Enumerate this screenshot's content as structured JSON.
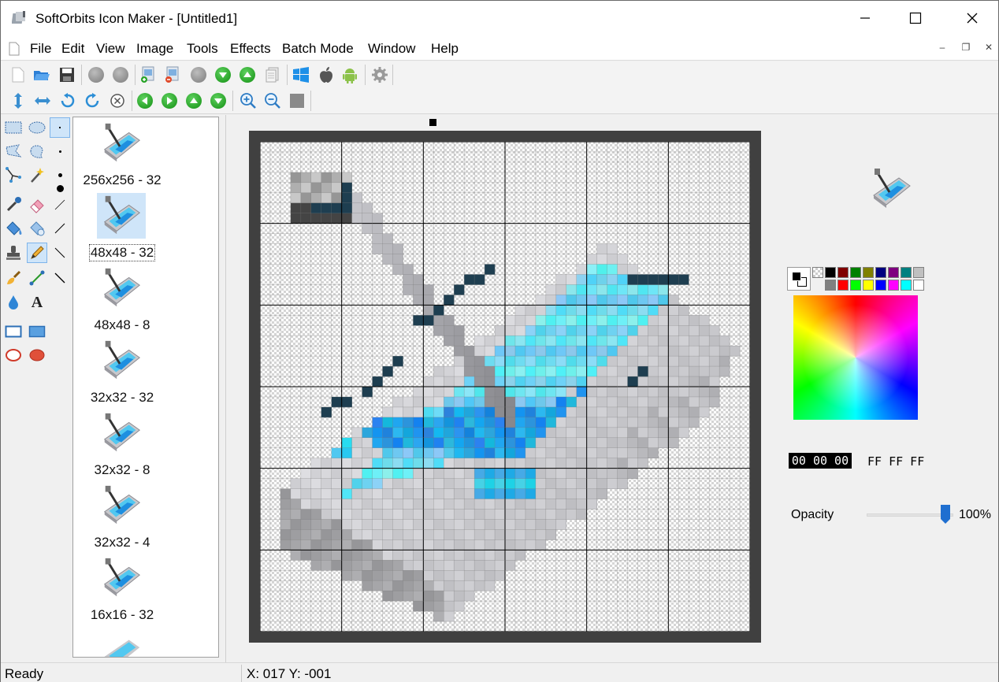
{
  "window": {
    "title": "SoftOrbits Icon Maker - [Untitled1]"
  },
  "menu": [
    "File",
    "Edit",
    "View",
    "Image",
    "Tools",
    "Effects",
    "Batch Mode",
    "Window",
    "Help"
  ],
  "mdi_controls": [
    "–",
    "❐",
    "✕"
  ],
  "images": [
    {
      "label": "256x256 - 32",
      "selected": false
    },
    {
      "label": "48x48 - 32",
      "selected": true
    },
    {
      "label": "48x48 - 8",
      "selected": false
    },
    {
      "label": "32x32 - 32",
      "selected": false
    },
    {
      "label": "32x32 - 8",
      "selected": false
    },
    {
      "label": "32x32 - 4",
      "selected": false
    },
    {
      "label": "16x16 - 32",
      "selected": false
    }
  ],
  "palette": {
    "row1": [
      "#000000",
      "#800000",
      "#008000",
      "#808000",
      "#000080",
      "#800080",
      "#008080",
      "#c0c0c0"
    ],
    "row2": [
      "#808080",
      "#ff0000",
      "#00ff00",
      "#ffff00",
      "#0000ff",
      "#ff00ff",
      "#00ffff",
      "#ffffff"
    ]
  },
  "color": {
    "foreground_code": "00 00 00",
    "background_code": "FF FF FF"
  },
  "opacity": {
    "label": "Opacity",
    "value_text": "100%",
    "value": 1.0
  },
  "status": {
    "left": "Ready",
    "coords": "X: 017 Y: -001"
  },
  "icons": {
    "toolbar1": [
      "new-icon",
      "open-icon",
      "save-icon",
      "gray-circle-icon",
      "gray-circle-icon",
      "add-image-icon",
      "remove-image-icon",
      "gray-circle-icon",
      "move-down-icon",
      "move-up-icon",
      "document-icon",
      "windows-icon",
      "apple-icon",
      "android-icon",
      "settings-icon"
    ],
    "toolbar2": [
      "flip-vertical-icon",
      "flip-horizontal-icon",
      "rotate-left-icon",
      "rotate-right-icon",
      "clear-icon",
      "arrow-left-icon",
      "arrow-right-icon",
      "arrow-up-icon",
      "arrow-down-icon",
      "zoom-in-icon",
      "zoom-out-icon",
      "actual-size-icon"
    ]
  }
}
